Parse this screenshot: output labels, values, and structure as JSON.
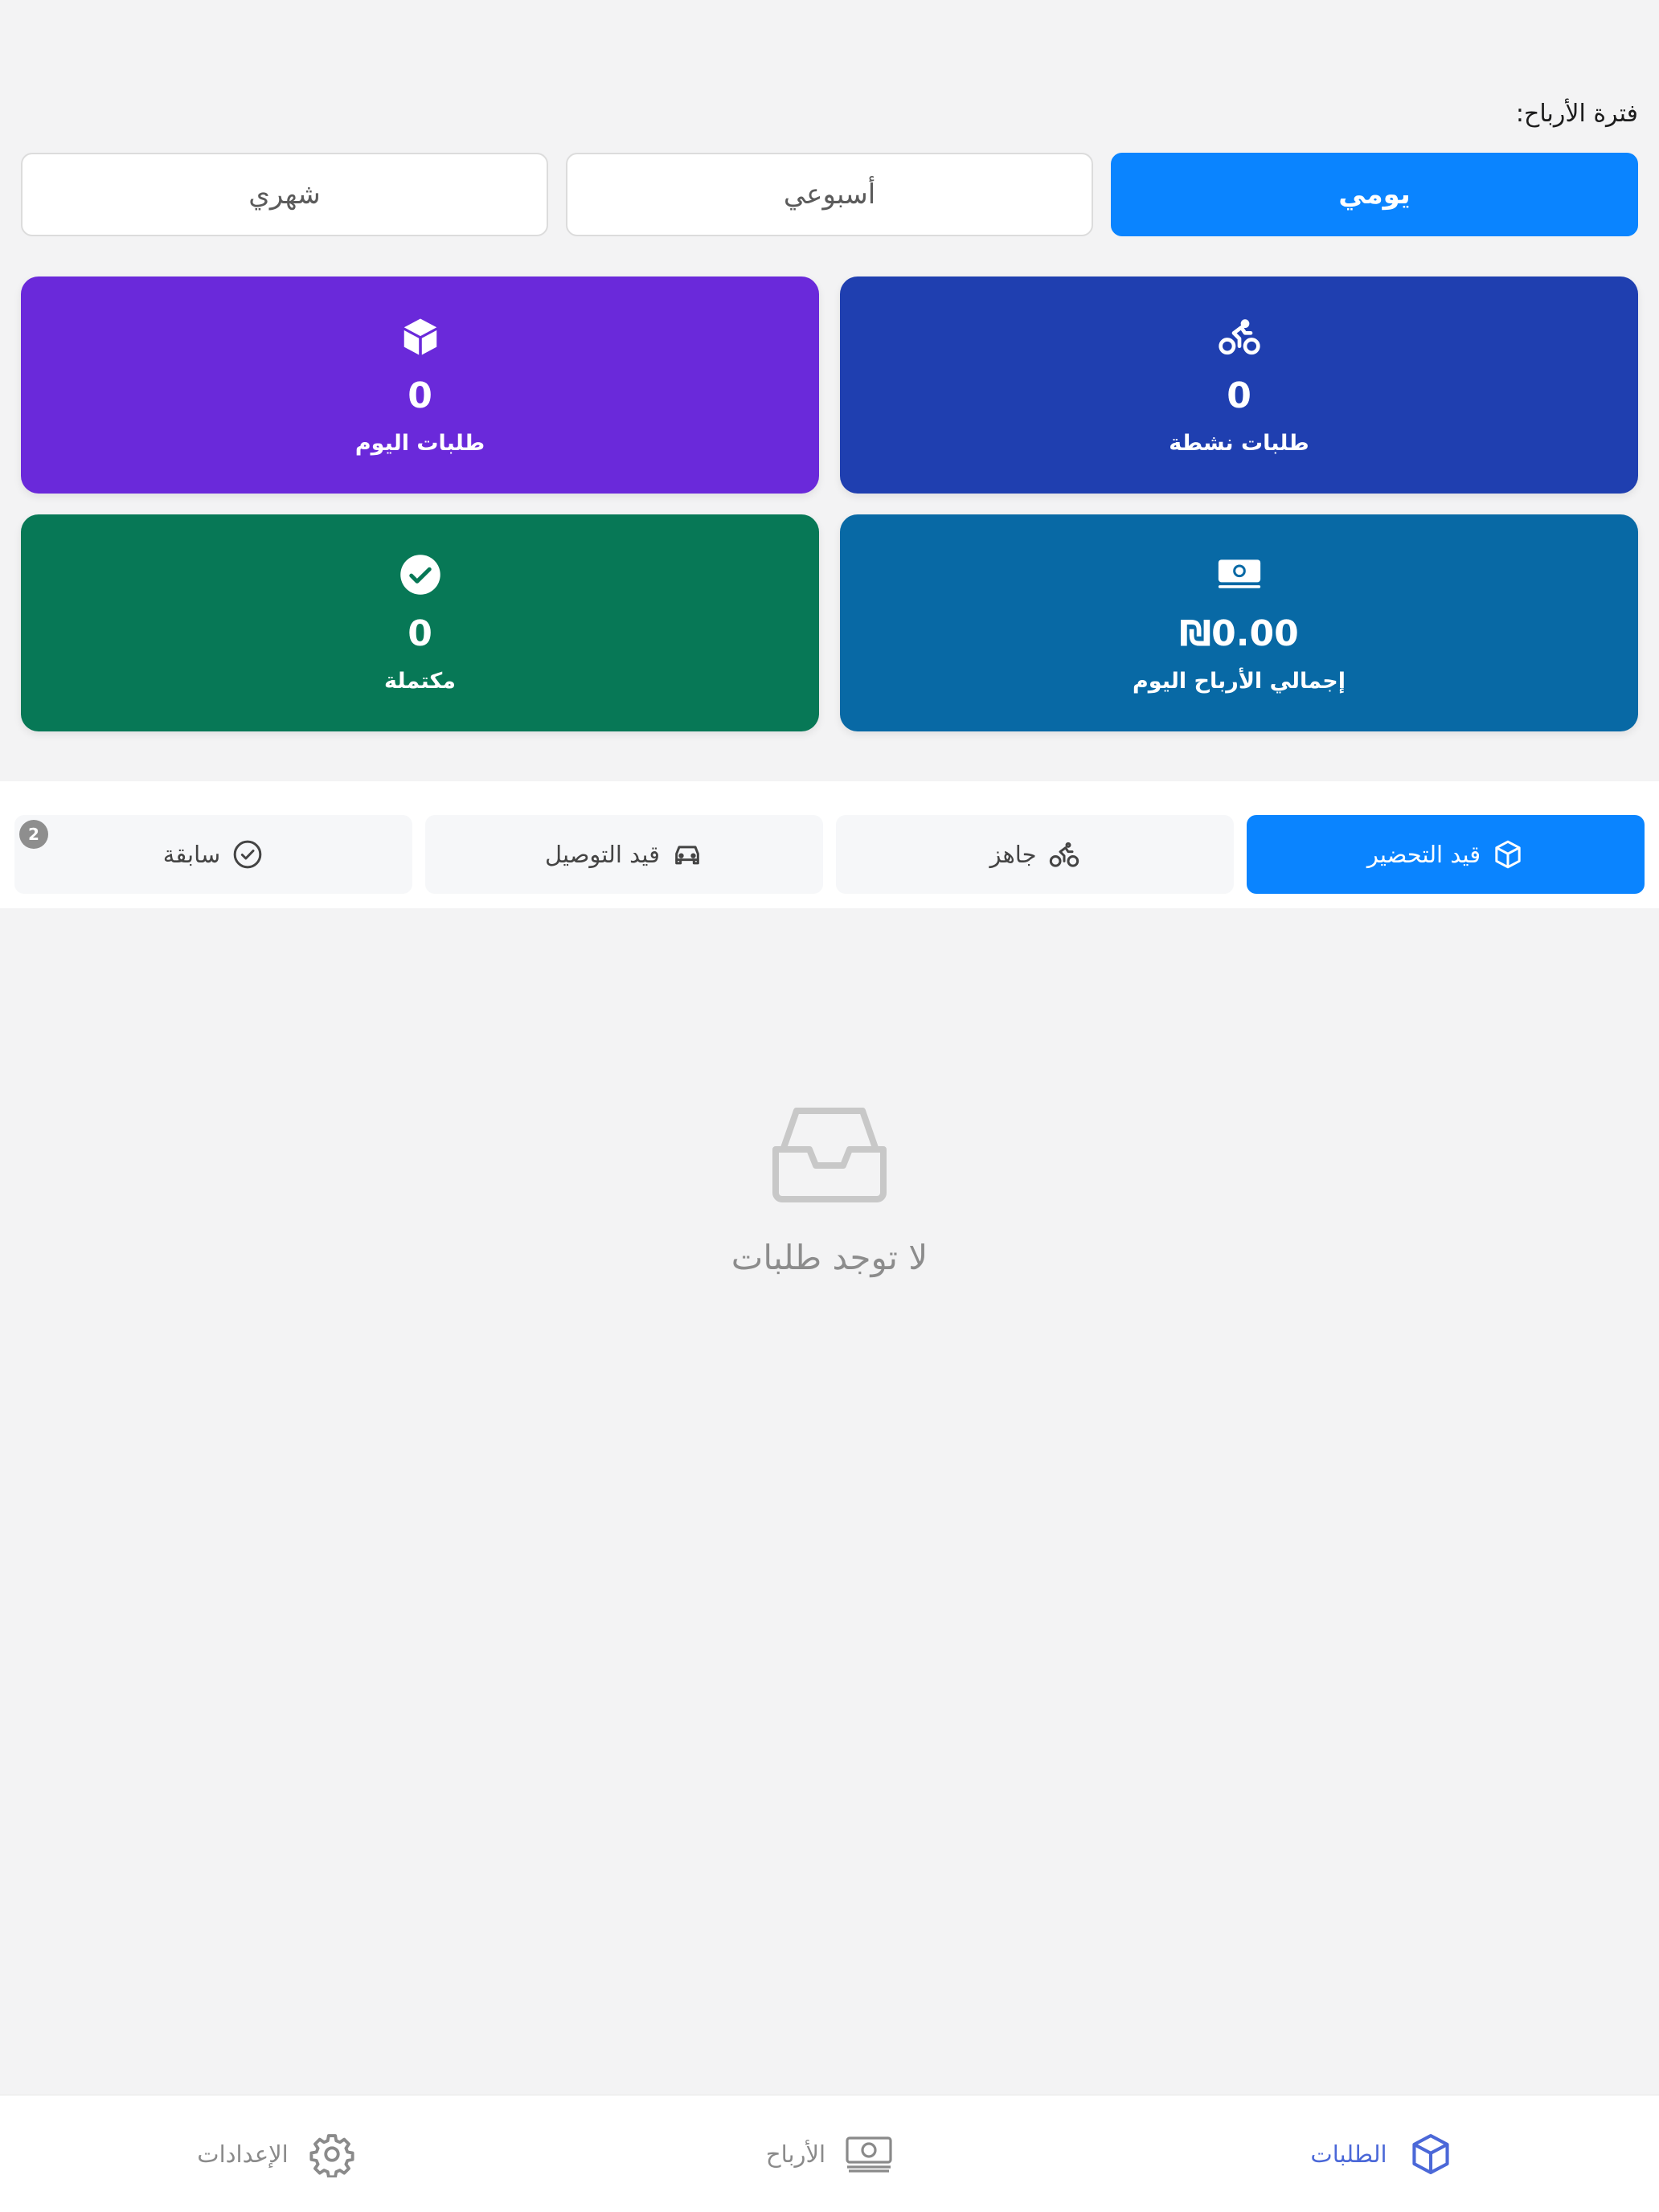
{
  "period": {
    "label": "فترة الأرباح:",
    "options": [
      {
        "label": "يومي",
        "active": true
      },
      {
        "label": "أسبوعي",
        "active": false
      },
      {
        "label": "شهري",
        "active": false
      }
    ]
  },
  "stats": {
    "active_orders": {
      "value": "0",
      "label": "طلبات نشطة",
      "icon": "bicycle-icon"
    },
    "today_orders": {
      "value": "0",
      "label": "طلبات اليوم",
      "icon": "cube-icon"
    },
    "today_earnings": {
      "value": "₪0.00",
      "label": "إجمالي الأرباح اليوم",
      "icon": "money-icon"
    },
    "completed": {
      "value": "0",
      "label": "مكتملة",
      "icon": "check-circle-icon"
    }
  },
  "tabs": [
    {
      "label": "قيد التحضير",
      "icon": "cube-icon",
      "active": true
    },
    {
      "label": "جاهز",
      "icon": "bicycle-icon",
      "active": false
    },
    {
      "label": "قيد التوصيل",
      "icon": "car-icon",
      "active": false
    },
    {
      "label": "سابقة",
      "icon": "check-circle-icon",
      "active": false,
      "badge": "2"
    }
  ],
  "empty_state": {
    "text": "لا توجد طلبات",
    "icon": "inbox-icon"
  },
  "bottom_nav": [
    {
      "label": "الطلبات",
      "icon": "cube-icon",
      "active": true
    },
    {
      "label": "الأرباح",
      "icon": "money-icon",
      "active": false
    },
    {
      "label": "الإعدادات",
      "icon": "gear-icon",
      "active": false
    }
  ],
  "colors": {
    "primary": "#0a84ff",
    "active_orders_card": "#1f3fb0",
    "today_orders_card": "#6a29da",
    "earnings_card": "#0869a5",
    "completed_card": "#077856",
    "nav_active": "#4b68d8"
  }
}
